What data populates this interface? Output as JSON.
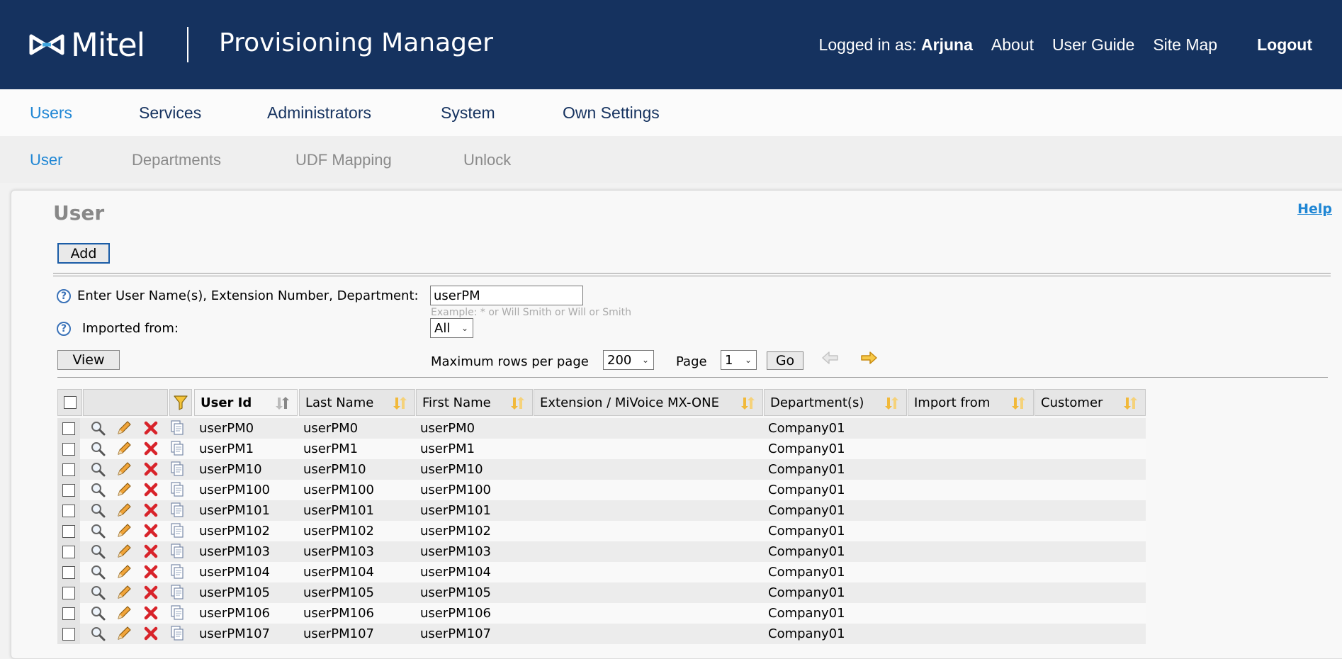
{
  "header": {
    "logo_text": "Mitel",
    "app_title": "Provisioning Manager",
    "logged_in_label": "Logged in as:",
    "logged_in_user": "Arjuna",
    "links": [
      "About",
      "User Guide",
      "Site Map"
    ],
    "logout": "Logout"
  },
  "main_nav": [
    "Users",
    "Services",
    "Administrators",
    "System",
    "Own Settings"
  ],
  "sub_nav": [
    "User",
    "Departments",
    "UDF Mapping",
    "Unlock"
  ],
  "page": {
    "title": "User",
    "help": "Help",
    "add_button": "Add",
    "search_label": "Enter User Name(s), Extension Number, Department:",
    "search_value": "userPM",
    "search_hint": "Example: * or Will Smith or Will or Smith",
    "imported_label": "Imported from:",
    "imported_value": "All",
    "view_button": "View",
    "max_rows_label": "Maximum rows per page",
    "max_rows_value": "200",
    "page_label": "Page",
    "page_value": "1",
    "go_button": "Go"
  },
  "table": {
    "columns": [
      "User Id",
      "Last Name",
      "First Name",
      "Extension / MiVoice MX-ONE",
      "Department(s)",
      "Import from",
      "Customer"
    ],
    "rows": [
      [
        "userPM0",
        "userPM0",
        "userPM0",
        "",
        "Company01",
        "",
        ""
      ],
      [
        "userPM1",
        "userPM1",
        "userPM1",
        "",
        "Company01",
        "",
        ""
      ],
      [
        "userPM10",
        "userPM10",
        "userPM10",
        "",
        "Company01",
        "",
        ""
      ],
      [
        "userPM100",
        "userPM100",
        "userPM100",
        "",
        "Company01",
        "",
        ""
      ],
      [
        "userPM101",
        "userPM101",
        "userPM101",
        "",
        "Company01",
        "",
        ""
      ],
      [
        "userPM102",
        "userPM102",
        "userPM102",
        "",
        "Company01",
        "",
        ""
      ],
      [
        "userPM103",
        "userPM103",
        "userPM103",
        "",
        "Company01",
        "",
        ""
      ],
      [
        "userPM104",
        "userPM104",
        "userPM104",
        "",
        "Company01",
        "",
        ""
      ],
      [
        "userPM105",
        "userPM105",
        "userPM105",
        "",
        "Company01",
        "",
        ""
      ],
      [
        "userPM106",
        "userPM106",
        "userPM106",
        "",
        "Company01",
        "",
        ""
      ],
      [
        "userPM107",
        "userPM107",
        "userPM107",
        "",
        "Company01",
        "",
        ""
      ]
    ]
  },
  "icons": {
    "row_actions": [
      "magnifier-icon",
      "pencil-icon",
      "delete-x-icon",
      "copy-document-icon"
    ],
    "filter": "funnel-icon",
    "sort": "sort-arrows-icon",
    "prev": "left-arrow-icon",
    "next": "right-arrow-icon"
  },
  "colors": {
    "header_bg": "#15325f",
    "active_link": "#1f86d4",
    "delete_red": "#d8232a",
    "arrow_gold": "#e8a416"
  }
}
